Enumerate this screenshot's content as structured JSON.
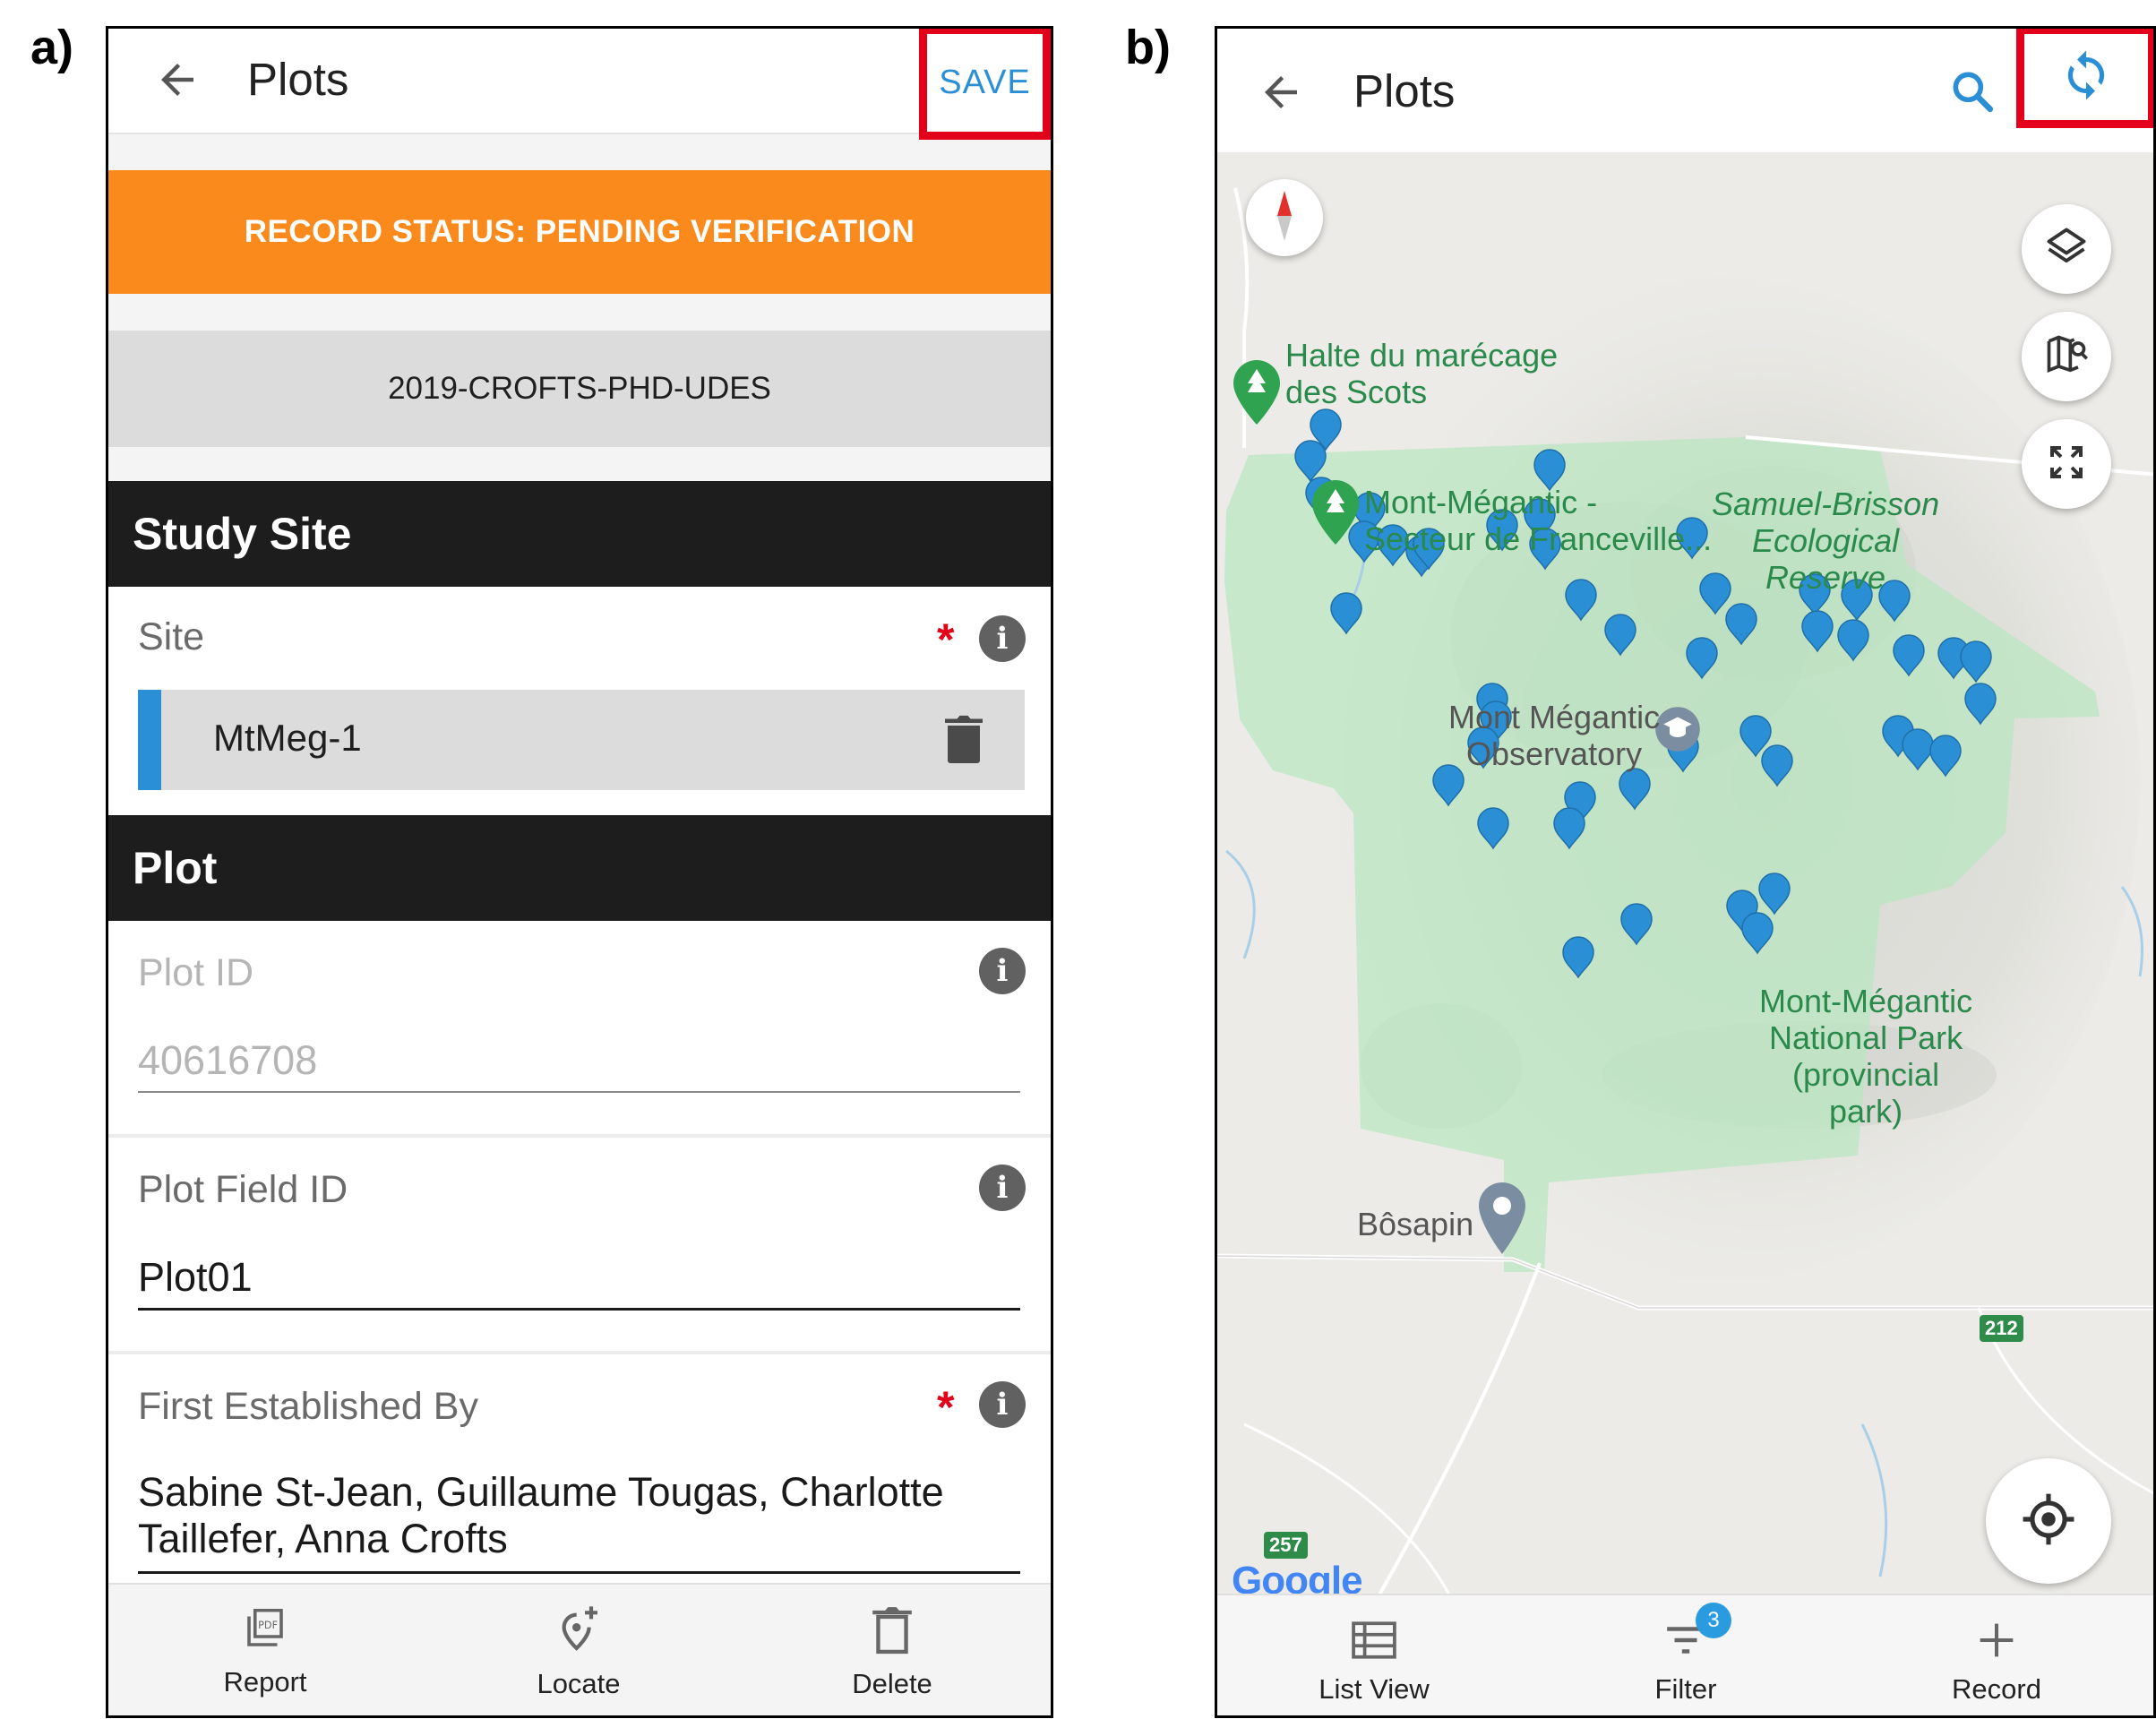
{
  "panel_labels": {
    "a": "a)",
    "b": "b)"
  },
  "panel_a": {
    "title": "Plots",
    "save_label": "SAVE",
    "record_status": "RECORD STATUS: PENDING VERIFICATION",
    "project": "2019-CROFTS-PHD-UDES",
    "study_site_header": "Study Site",
    "site": {
      "label": "Site",
      "required_mark": "*",
      "value": "MtMeg-1"
    },
    "plot_header": "Plot",
    "plot_id": {
      "label": "Plot ID",
      "value": "40616708"
    },
    "plot_field_id": {
      "label": "Plot Field ID",
      "value": "Plot01"
    },
    "first_established_by": {
      "label": "First Established By",
      "required_mark": "*",
      "value": "Sabine St-Jean, Guillaume Tougas, Charlotte Taillefer, Anna Crofts"
    },
    "bottom_nav": [
      {
        "label": "Report",
        "icon": "pdf-icon"
      },
      {
        "label": "Locate",
        "icon": "add-location-icon"
      },
      {
        "label": "Delete",
        "icon": "trash-icon"
      }
    ]
  },
  "panel_b": {
    "title": "Plots",
    "map_labels": {
      "halte": "Halte du marécage\ndes Scots",
      "mont_megantic_franceville": "Mont-Mégantic -\nSecteur de Franceville...",
      "samuel_brisson": "Samuel-Brisson\nEcological\nReserve",
      "observatory": "Mont Mégantic\nObservatory",
      "national_park": "Mont-Mégantic\nNational Park\n(provincial\npark)",
      "bosapin": "Bôsapin",
      "route_212": "212",
      "route_257": "257",
      "google": "Google"
    },
    "filter_count": "3",
    "bottom_nav": [
      {
        "label": "List View",
        "icon": "list-icon"
      },
      {
        "label": "Filter",
        "icon": "filter-icon"
      },
      {
        "label": "Record",
        "icon": "plus-icon"
      }
    ]
  },
  "colors": {
    "status_orange": "#fb8a1c",
    "accent_blue": "#2b8fd6",
    "highlight_red": "#e3001b",
    "section_dark": "#1d1d1d",
    "park_green": "#b8e6bf",
    "marker_blue": "#2b8fd6"
  }
}
